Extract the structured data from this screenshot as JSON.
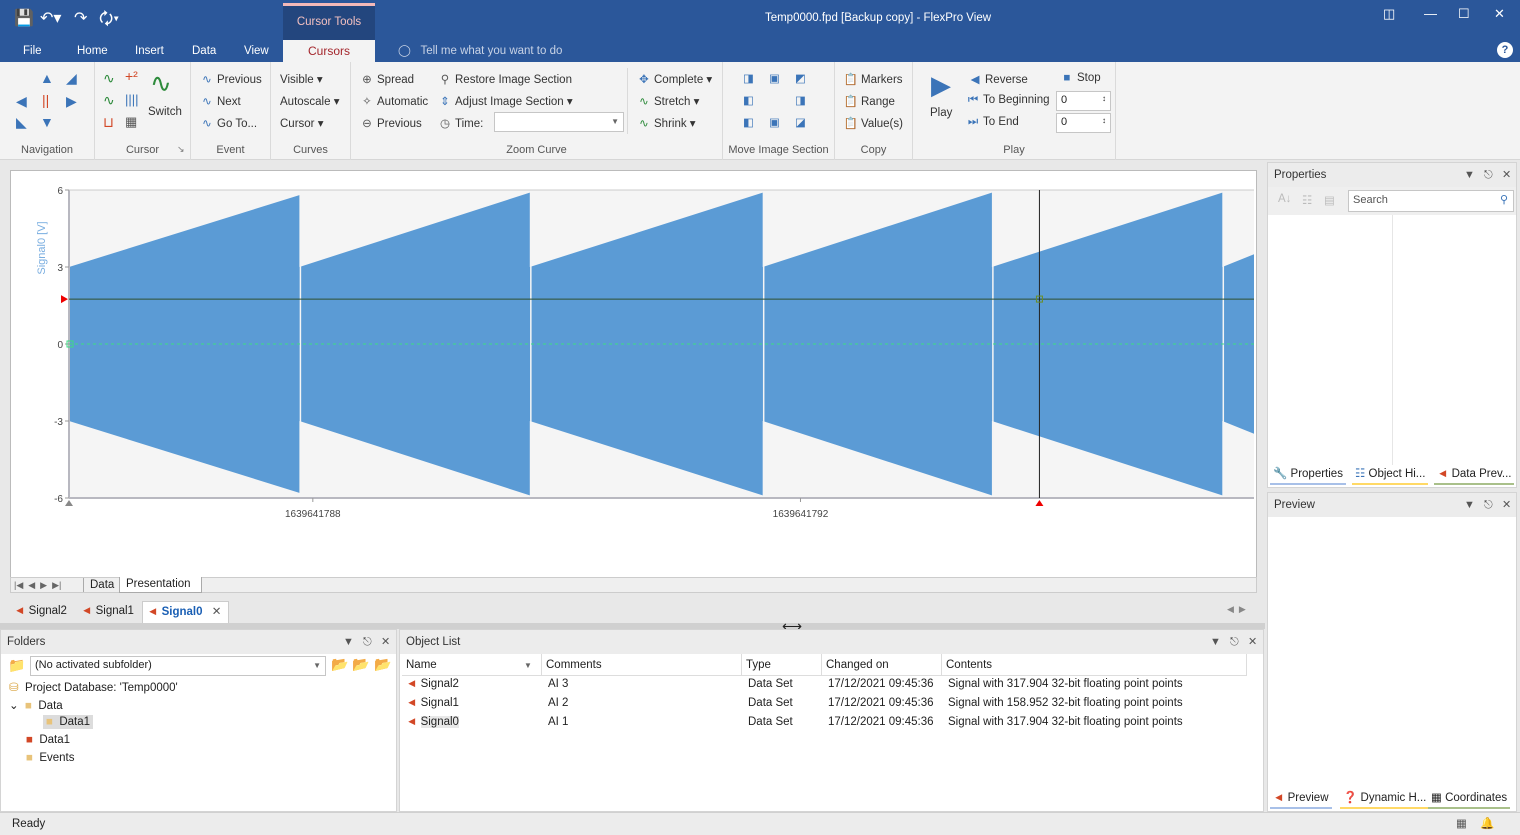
{
  "title": "Temp0000.fpd [Backup copy] - FlexPro View",
  "context_group": "Cursor Tools",
  "menu_tabs": [
    "File",
    "Home",
    "Insert",
    "Data",
    "View"
  ],
  "active_tab": "Cursors",
  "tell_me": "Tell me what you want to do",
  "ribbon": {
    "navigation": {
      "label": "Navigation"
    },
    "cursor": {
      "label": "Cursor",
      "switch": "Switch"
    },
    "event": {
      "label": "Event",
      "previous": "Previous",
      "next": "Next",
      "goto": "Go To..."
    },
    "curves": {
      "label": "Curves",
      "visible": "Visible",
      "autoscale": "Autoscale",
      "cursor": "Cursor"
    },
    "zoom": {
      "label": "Zoom Curve",
      "spread": "Spread",
      "automatic": "Automatic",
      "previous": "Previous",
      "restore": "Restore Image Section",
      "adjust": "Adjust Image Section",
      "time_label": "Time:",
      "time_value": "",
      "complete": "Complete",
      "stretch": "Stretch",
      "shrink": "Shrink"
    },
    "move": {
      "label": "Move Image Section"
    },
    "copy": {
      "label": "Copy",
      "markers": "Markers",
      "range": "Range",
      "values": "Value(s)"
    },
    "play": {
      "label": "Play",
      "play": "Play",
      "reverse": "Reverse",
      "to_beginning": "To Beginning",
      "to_end": "To End",
      "stop": "Stop",
      "begin_value": "0",
      "end_value": "0"
    }
  },
  "chart_data": {
    "type": "area",
    "ylabel": "Signal0 [V]",
    "ylim": [
      -6,
      6
    ],
    "yticks": [
      "6",
      "3",
      "0",
      "-3",
      "-6"
    ],
    "xlim": [
      1639641786.0,
      1639641795.72
    ],
    "xticks": [
      "1639641788",
      "1639641792"
    ],
    "xtick_values": [
      1639641788,
      1639641792
    ],
    "grid": false,
    "color": "#5b9bd5",
    "envelope": [
      {
        "x": 1639641786.0,
        "amp": 3.0
      },
      {
        "x": 1639641787.89,
        "amp": 5.8
      },
      {
        "x": 1639641787.89,
        "amp": 3.0
      },
      {
        "x": 1639641789.78,
        "amp": 5.9
      },
      {
        "x": 1639641789.78,
        "amp": 3.0
      },
      {
        "x": 1639641791.69,
        "amp": 5.9
      },
      {
        "x": 1639641791.69,
        "amp": 3.0
      },
      {
        "x": 1639641793.57,
        "amp": 5.9
      },
      {
        "x": 1639641793.57,
        "amp": 3.0
      },
      {
        "x": 1639641795.46,
        "amp": 5.9
      },
      {
        "x": 1639641795.46,
        "amp": 3.0
      },
      {
        "x": 1639641795.72,
        "amp": 3.5
      }
    ],
    "h_cursor_y": 1.75,
    "v_cursor_x": 1639641793.96
  },
  "sheet_tabs": [
    "Data",
    "Presentation"
  ],
  "doc_tabs": [
    "Signal2",
    "Signal1",
    "Signal0"
  ],
  "folders": {
    "title": "Folders",
    "subfolder": "(No activated subfolder)",
    "tree": [
      "Project Database: 'Temp0000'",
      "Data",
      "Data1",
      "Data1",
      "Events"
    ]
  },
  "object_list": {
    "title": "Object List",
    "columns": [
      "Name",
      "Comments",
      "Type",
      "Changed on",
      "Contents"
    ],
    "rows": [
      [
        "Signal2",
        "AI 3",
        "Data Set",
        "17/12/2021 09:45:36",
        "Signal with 317.904 32-bit floating point points"
      ],
      [
        "Signal1",
        "AI 2",
        "Data Set",
        "17/12/2021 09:45:36",
        "Signal with 158.952 32-bit floating point points"
      ],
      [
        "Signal0",
        "AI 1",
        "Data Set",
        "17/12/2021 09:45:36",
        "Signal with 317.904 32-bit floating point points"
      ]
    ]
  },
  "properties": {
    "title": "Properties",
    "search_placeholder": "Search",
    "tabs": [
      "Properties",
      "Object Hi...",
      "Data Prev..."
    ]
  },
  "preview": {
    "title": "Preview",
    "tabs": [
      "Preview",
      "Dynamic H...",
      "Coordinates"
    ]
  },
  "status": "Ready"
}
